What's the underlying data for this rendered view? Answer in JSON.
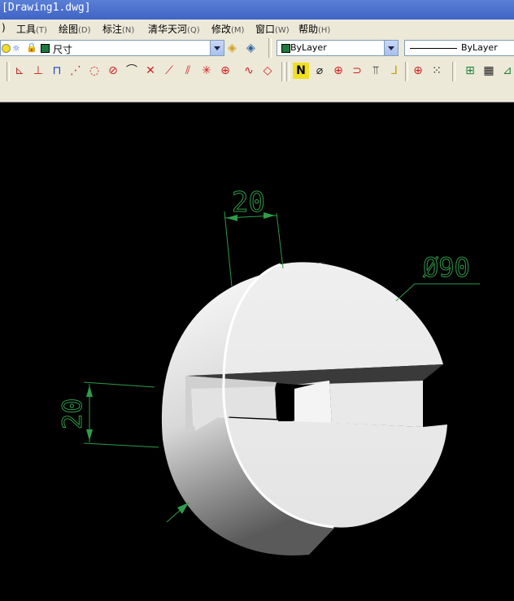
{
  "window": {
    "title": "[Drawing1.dwg]"
  },
  "menu": [
    {
      "label": ")",
      "acc": ""
    },
    {
      "label": "工具",
      "acc": "(T)"
    },
    {
      "label": "绘图",
      "acc": "(D)"
    },
    {
      "label": "标注",
      "acc": "(N)"
    },
    {
      "label": "清华天河",
      "acc": "(Q)"
    },
    {
      "label": "修改",
      "acc": "(M)"
    },
    {
      "label": "窗口",
      "acc": "(W)"
    },
    {
      "label": "帮助",
      "acc": "(H)"
    }
  ],
  "layer": {
    "name": "尺寸",
    "swatch_color": "#1e7a3c"
  },
  "color_combo": {
    "value": "ByLayer",
    "swatch_color": "#1e7a3c"
  },
  "linetype_combo": {
    "value": "ByLayer"
  },
  "draw_tools": [
    "ucs-icon",
    "dim-linear-icon",
    "dim-aligned-icon",
    "dim-ordinate-icon",
    "dim-radius-icon",
    "dim-diameter-icon",
    "dim-angular-icon",
    "quick-dim-icon",
    "baseline-icon",
    "continue-icon",
    "leader-icon",
    "tolerance-icon",
    "center-mark-icon",
    "dim-edit-icon",
    "dim-text-edit-icon",
    "properties-icon",
    "match-icon",
    "layer-icon",
    "orbit-icon",
    "snap-icon",
    "grid-icon"
  ],
  "drawing": {
    "dim_top": "20",
    "dim_left": "20",
    "dim_diameter": "Ø90"
  },
  "colors": {
    "dimension": "#2e9c4a",
    "background": "#000000"
  }
}
